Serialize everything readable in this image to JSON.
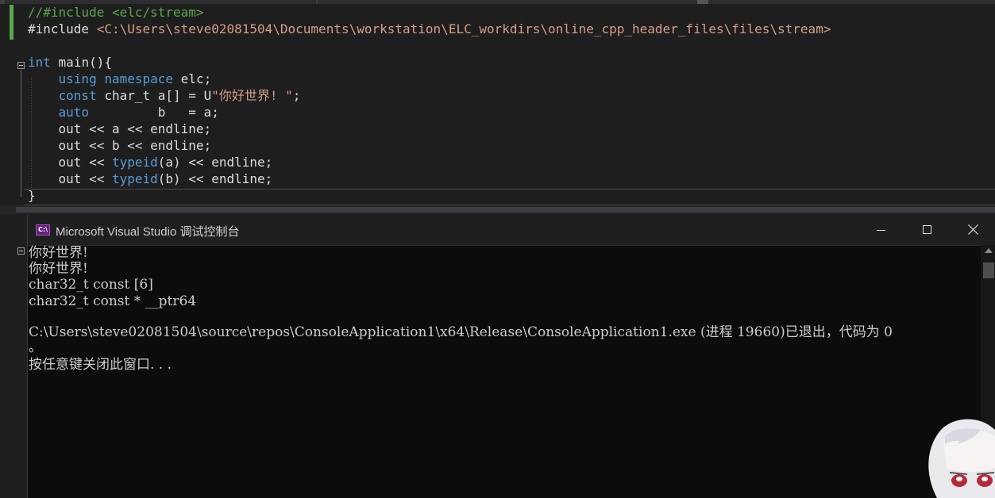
{
  "editor": {
    "lines": [
      {
        "parts": [
          [
            "cmt",
            "//#include <elc/stream>"
          ]
        ]
      },
      {
        "parts": [
          [
            "txt",
            "#include "
          ],
          [
            "str",
            "<C:\\Users\\steve02081504\\Documents\\workstation\\ELC_workdirs\\online_cpp_header_files\\files\\stream>"
          ]
        ]
      },
      {
        "parts": []
      },
      {
        "parts": [
          [
            "kw",
            "int"
          ],
          [
            "txt",
            " main(){"
          ]
        ]
      },
      {
        "parts": [
          [
            "txt",
            "    "
          ],
          [
            "kw",
            "using"
          ],
          [
            "txt",
            " "
          ],
          [
            "kw",
            "namespace"
          ],
          [
            "txt",
            " elc;"
          ]
        ]
      },
      {
        "parts": [
          [
            "txt",
            "    "
          ],
          [
            "kw",
            "const"
          ],
          [
            "txt",
            " char_t a[] = U"
          ],
          [
            "str",
            "\"你好世界! \""
          ],
          [
            "txt",
            ";"
          ]
        ]
      },
      {
        "parts": [
          [
            "txt",
            "    "
          ],
          [
            "kw",
            "auto"
          ],
          [
            "txt",
            "         b   = a;"
          ]
        ]
      },
      {
        "parts": [
          [
            "txt",
            "    out << a << endline;"
          ]
        ]
      },
      {
        "parts": [
          [
            "txt",
            "    out << b << endline;"
          ]
        ]
      },
      {
        "parts": [
          [
            "txt",
            "    out << "
          ],
          [
            "kw",
            "typeid"
          ],
          [
            "txt",
            "(a) << endline;"
          ]
        ]
      },
      {
        "parts": [
          [
            "txt",
            "    out << "
          ],
          [
            "kw",
            "typeid"
          ],
          [
            "txt",
            "(b) << endline;"
          ]
        ]
      },
      {
        "parts": [
          [
            "txt",
            "}"
          ]
        ]
      }
    ]
  },
  "console": {
    "title": "Microsoft Visual Studio 调试控制台",
    "icon_label": "C:\\",
    "output_lines": [
      "你好世界!",
      "你好世界!",
      "char32_t const [6]",
      "char32_t const * __ptr64",
      "",
      "C:\\Users\\steve02081504\\source\\repos\\ConsoleApplication1\\x64\\Release\\ConsoleApplication1.exe (进程 19660)已退出，代码为 0",
      "。",
      "按任意键关闭此窗口. . ."
    ]
  },
  "colors": {
    "editor_bg": "#1e1e1e",
    "keyword": "#569cd6",
    "comment": "#57a64a",
    "string": "#d69d85",
    "console_bg": "#0c0c0c"
  }
}
